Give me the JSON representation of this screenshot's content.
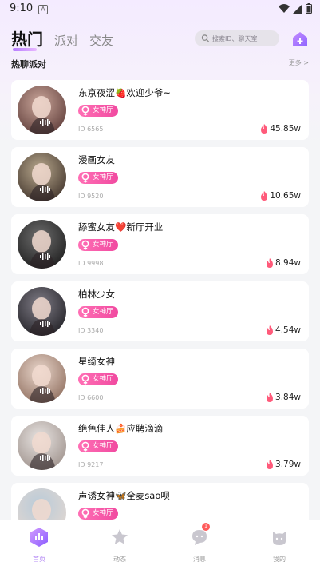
{
  "status": {
    "time": "9:10",
    "notification_letter": "A"
  },
  "tabs": [
    {
      "label": "热门",
      "active": true
    },
    {
      "label": "派对",
      "active": false
    },
    {
      "label": "交友",
      "active": false
    }
  ],
  "search": {
    "placeholder": "搜索ID、聊天室"
  },
  "section": {
    "title": "热聊派对",
    "more": "更多 >"
  },
  "rooms": [
    {
      "name": "东京夜涩🍓欢迎少爷~",
      "tag": "女神厅",
      "id": "ID 6565",
      "heat": "45.85w",
      "avatar_colors": [
        "#caa69a",
        "#5c3a37"
      ]
    },
    {
      "name": "漫画女友",
      "tag": "女神厅",
      "id": "ID 9520",
      "heat": "10.65w",
      "avatar_colors": [
        "#b9a98e",
        "#3d3028"
      ]
    },
    {
      "name": "舔蜜女友❤️新厅开业",
      "tag": "女神厅",
      "id": "ID 9998",
      "heat": "8.94w",
      "avatar_colors": [
        "#6d6d6d",
        "#1b1b1b"
      ]
    },
    {
      "name": "柏林少女",
      "tag": "女神厅",
      "id": "ID 3340",
      "heat": "4.54w",
      "avatar_colors": [
        "#7f7c86",
        "#1f1e23"
      ]
    },
    {
      "name": "星绮女神",
      "tag": "女神厅",
      "id": "ID 6600",
      "heat": "3.84w",
      "avatar_colors": [
        "#e9d6cb",
        "#8d6c5c"
      ]
    },
    {
      "name": "绝色佳人🍰应聘滴滴",
      "tag": "女神厅",
      "id": "ID 9217",
      "heat": "3.79w",
      "avatar_colors": [
        "#e8e4e2",
        "#9c8f89"
      ]
    },
    {
      "name": "声诱女神🦋全麦sao呗",
      "tag": "女神厅",
      "id": "",
      "heat": "",
      "avatar_colors": [
        "#b9cbd9",
        "#e3d7d0"
      ]
    }
  ],
  "nav": [
    {
      "label": "首页",
      "icon": "home-icon",
      "active": true
    },
    {
      "label": "动态",
      "icon": "star-icon",
      "active": false
    },
    {
      "label": "消息",
      "icon": "message-icon",
      "active": false,
      "badge": "1"
    },
    {
      "label": "我的",
      "icon": "profile-icon",
      "active": false
    }
  ],
  "colors": {
    "accent": "#b68cf5",
    "badge_pink": "#f14aa0",
    "heat_icon": "#ff5a7a"
  }
}
